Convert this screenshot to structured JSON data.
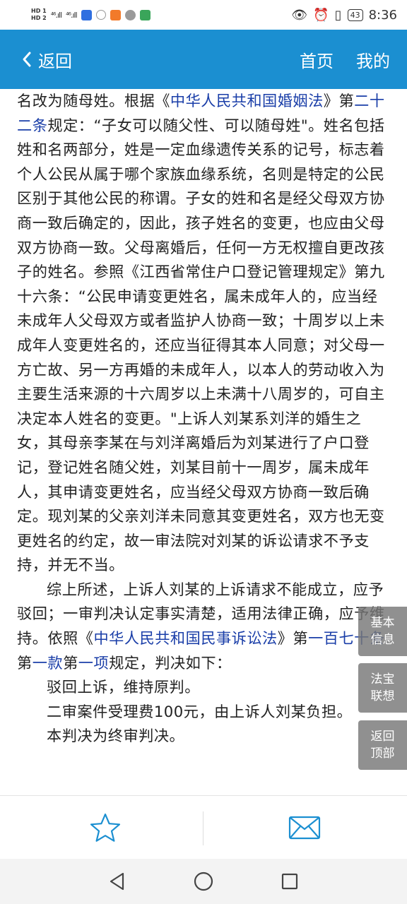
{
  "status_bar": {
    "hd1": "HD 1",
    "hd2": "HD 2",
    "signal1": "⁴⁶.ıll",
    "signal2": "⁴⁶.ıll",
    "battery": "43",
    "time": "8:36"
  },
  "header": {
    "back_label": "返回",
    "home_label": "首页",
    "mine_label": "我的"
  },
  "content": {
    "p1": [
      {
        "t": "名改为随母姓。根据《"
      },
      {
        "t": "中华人民共和国婚姻法",
        "link": true
      },
      {
        "t": "》第"
      },
      {
        "t": "二十二条",
        "link": true
      },
      {
        "t": "规定：“子女可以随父性、可以随母姓\"。姓名包括姓和名两部分，姓是一定血缘遗传关系的记号，标志着个人公民从属于哪个家族血缘系统，名则是特定的公民区别于其他公民的称谓。子女的姓和名是经父母双方协商一致后确定的，因此，孩子姓名的变更，也应由父母双方协商一致。父母离婚后，任何一方无权擅自更改孩子的姓名。参照《江西省常住户口登记管理规定》第九十六条：“公民申请变更姓名，属未成年人的，应当经未成年人父母双方或者监护人协商一致；十周岁以上未成年人变更姓名的，还应当征得其本人同意；对父母一方亡故、另一方再婚的未成年人，以本人的劳动收入为主要生活来源的十六周岁以上未满十八周岁的，可自主决定本人姓名的变更。\"上诉人刘某系刘洋的婚生之女，其母亲李某在与刘洋离婚后为刘某进行了户口登记，登记姓名随父姓，刘某目前十一周岁，属未成年人，其申请变更姓名，应当经父母双方协商一致后确定。现刘某的父亲刘洋未同意其变更姓名，双方也无变更姓名的约定，故一审法院对刘某的诉讼请求不予支持，并无不当。"
      }
    ],
    "p2": [
      {
        "t": "综上所述，上诉人刘某的上诉请求不能成立，应予驳回；一审判决认定事实清楚，适用法律正确，应予维持。依照《"
      },
      {
        "t": "中华人民共和国民事诉讼法",
        "link": true
      },
      {
        "t": "》第"
      },
      {
        "t": "一百七十条",
        "link": true
      },
      {
        "t": "第"
      },
      {
        "t": "一款",
        "link": true
      },
      {
        "t": "第"
      },
      {
        "t": "一项",
        "link": true
      },
      {
        "t": "规定，判决如下："
      }
    ],
    "p3": "驳回上诉，维持原判。",
    "p4": "二审案件受理费100元，由上诉人刘某负担。",
    "p5": "本判决为终审判决。"
  },
  "float_buttons": {
    "basic_info": [
      "基本",
      "信息"
    ],
    "law_assoc": [
      "法宝",
      "联想"
    ],
    "back_top": [
      "返回",
      "顶部"
    ]
  },
  "icons": {
    "back": "chevron-left-icon",
    "favorite": "star-icon",
    "share": "envelope-icon",
    "sys_back": "triangle-back-icon",
    "sys_home": "circle-home-icon",
    "sys_recent": "square-recent-icon"
  },
  "colors": {
    "header_bg": "#1b8fd1",
    "link": "#1a3ea8",
    "icon_blue": "#1b8fd1"
  }
}
